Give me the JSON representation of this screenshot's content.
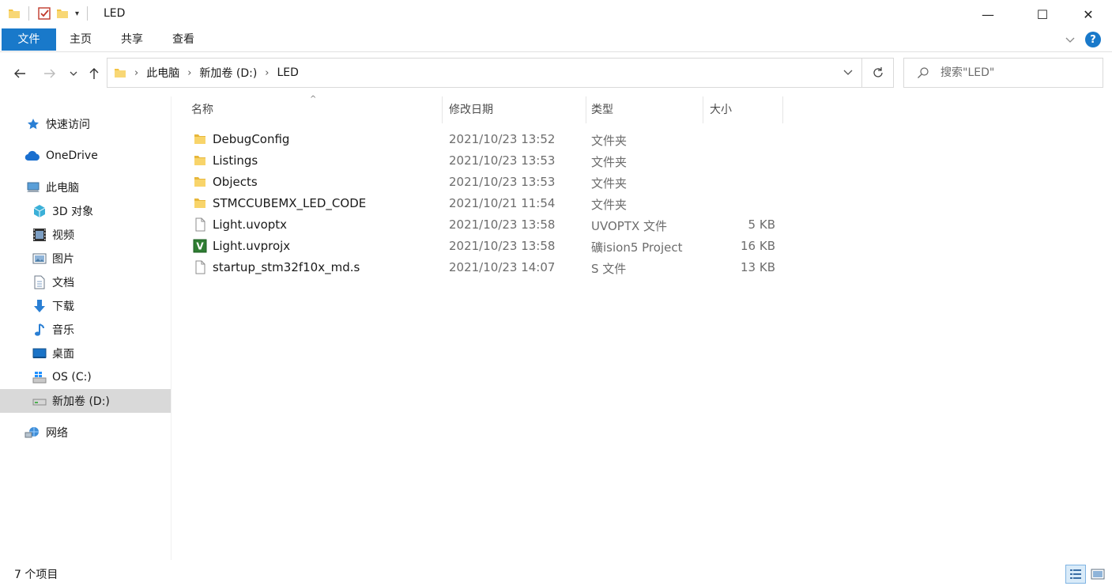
{
  "window": {
    "title": "LED",
    "minimize_glyph": "—",
    "maximize_glyph": "☐",
    "close_glyph": "✕"
  },
  "ribbon": {
    "tabs": [
      {
        "label": "文件",
        "active": true
      },
      {
        "label": "主页"
      },
      {
        "label": "共享"
      },
      {
        "label": "查看"
      }
    ],
    "help_glyph": "?"
  },
  "address": {
    "crumbs": [
      "此电脑",
      "新加卷 (D:)",
      "LED"
    ]
  },
  "search": {
    "placeholder": "搜索\"LED\""
  },
  "sidebar": {
    "items": [
      {
        "label": "快速访问",
        "icon": "star-icon"
      },
      {
        "label": "OneDrive",
        "icon": "cloud-icon"
      },
      {
        "label": "此电脑",
        "icon": "computer-icon"
      },
      {
        "label": "3D 对象",
        "icon": "cube-icon"
      },
      {
        "label": "视频",
        "icon": "film-icon"
      },
      {
        "label": "图片",
        "icon": "picture-icon"
      },
      {
        "label": "文档",
        "icon": "document-icon"
      },
      {
        "label": "下载",
        "icon": "download-arrow-icon"
      },
      {
        "label": "音乐",
        "icon": "music-note-icon"
      },
      {
        "label": "桌面",
        "icon": "desktop-icon"
      },
      {
        "label": "OS (C:)",
        "icon": "windows-drive-icon"
      },
      {
        "label": "新加卷 (D:)",
        "icon": "drive-icon",
        "selected": true
      },
      {
        "label": "网络",
        "icon": "network-icon"
      }
    ]
  },
  "columns": {
    "name": "名称",
    "date": "修改日期",
    "type": "类型",
    "size": "大小"
  },
  "files": [
    {
      "name": "DebugConfig",
      "date": "2021/10/23 13:52",
      "type": "文件夹",
      "size": "",
      "icon": "folder-icon"
    },
    {
      "name": "Listings",
      "date": "2021/10/23 13:53",
      "type": "文件夹",
      "size": "",
      "icon": "folder-icon"
    },
    {
      "name": "Objects",
      "date": "2021/10/23 13:53",
      "type": "文件夹",
      "size": "",
      "icon": "folder-icon"
    },
    {
      "name": "STMCCUBEMX_LED_CODE",
      "date": "2021/10/21 11:54",
      "type": "文件夹",
      "size": "",
      "icon": "folder-icon"
    },
    {
      "name": "Light.uvoptx",
      "date": "2021/10/23 13:58",
      "type": "UVOPTX 文件",
      "size": "5 KB",
      "icon": "blank-file-icon"
    },
    {
      "name": "Light.uvprojx",
      "date": "2021/10/23 13:58",
      "type": "礦ision5 Project",
      "size": "16 KB",
      "icon": "keil-project-icon"
    },
    {
      "name": "startup_stm32f10x_md.s",
      "date": "2021/10/23 14:07",
      "type": "S 文件",
      "size": "13 KB",
      "icon": "blank-file-icon"
    }
  ],
  "status": {
    "item_count": "7 个项目"
  },
  "colors": {
    "accent": "#1979ca",
    "folder": "#f4c342",
    "selected_bg": "#d9d9d9"
  }
}
